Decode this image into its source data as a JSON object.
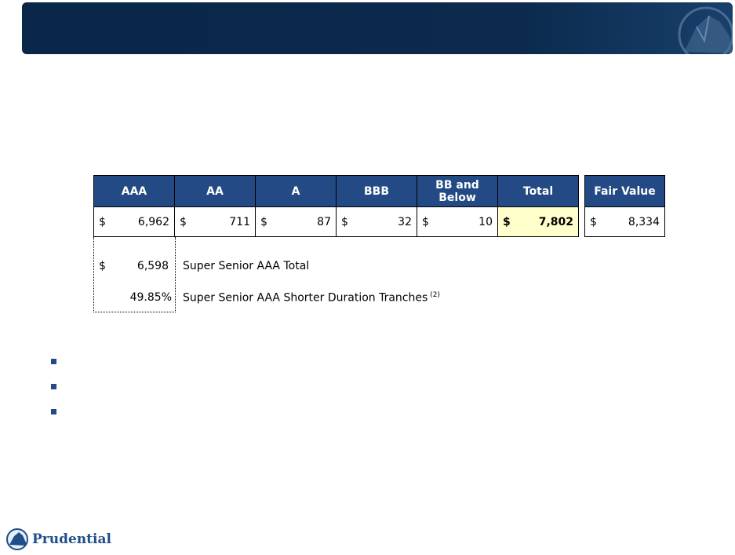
{
  "table": {
    "headers": [
      "AAA",
      "AA",
      "A",
      "BBB",
      "BB and Below",
      "Total"
    ],
    "currency": "$",
    "values": [
      "6,962",
      "711",
      "87",
      "32",
      "10",
      "7,802"
    ],
    "fair_value_header": "Fair Value",
    "fair_value": "8,334"
  },
  "sub": {
    "super_senior_total_value": "6,598",
    "super_senior_total_label": "Super Senior AAA Total",
    "shorter_duration_pct": "49.85%",
    "shorter_duration_label": "Super Senior AAA Shorter Duration Tranches",
    "footnote": "(2)"
  },
  "logo": {
    "text": "Prudential"
  },
  "colors": {
    "banner": "#0b2a4d",
    "header": "#234a84",
    "total_highlight": "#ffffcc"
  }
}
